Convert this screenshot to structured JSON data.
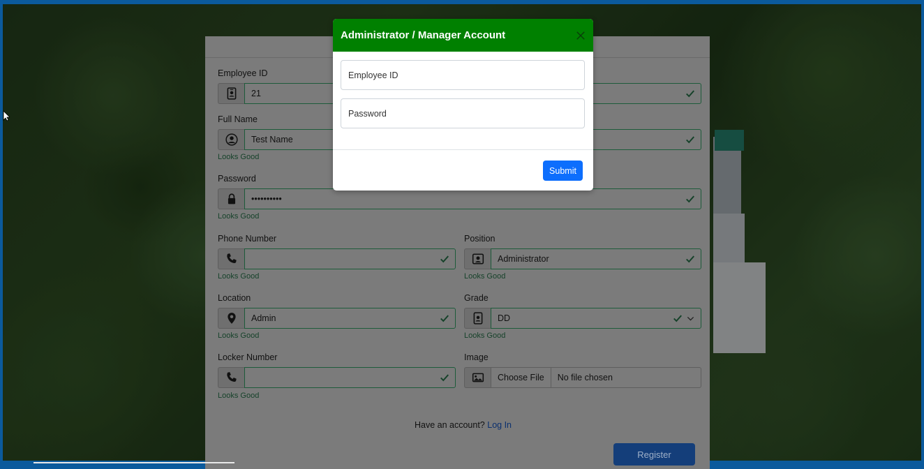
{
  "form": {
    "employee_id": {
      "label": "Employee ID",
      "value": "21"
    },
    "full_name": {
      "label": "Full Name",
      "value": "Test Name",
      "feedback": "Looks Good"
    },
    "password": {
      "label": "Password",
      "value": "••••••••••",
      "feedback": "Looks Good"
    },
    "phone": {
      "label": "Phone Number",
      "value": "",
      "feedback": "Looks Good"
    },
    "position": {
      "label": "Position",
      "value": "Administrator",
      "feedback": "Looks Good"
    },
    "location": {
      "label": "Location",
      "value": "Admin",
      "feedback": "Looks Good"
    },
    "grade": {
      "label": "Grade",
      "value": "DD",
      "feedback": "Looks Good"
    },
    "locker": {
      "label": "Locker Number",
      "value": "",
      "feedback": "Looks Good"
    },
    "image": {
      "label": "Image",
      "button": "Choose File",
      "status": "No file chosen"
    },
    "have_account_text": "Have an account?",
    "login_link": "Log In",
    "register_button": "Register"
  },
  "modal": {
    "title": "Administrator / Manager Account",
    "employee_id_placeholder": "Employee ID",
    "password_placeholder": "Password",
    "submit_label": "Submit"
  },
  "colors": {
    "modal_header": "#008000",
    "submit": "#0d6efd",
    "valid": "#198754"
  }
}
